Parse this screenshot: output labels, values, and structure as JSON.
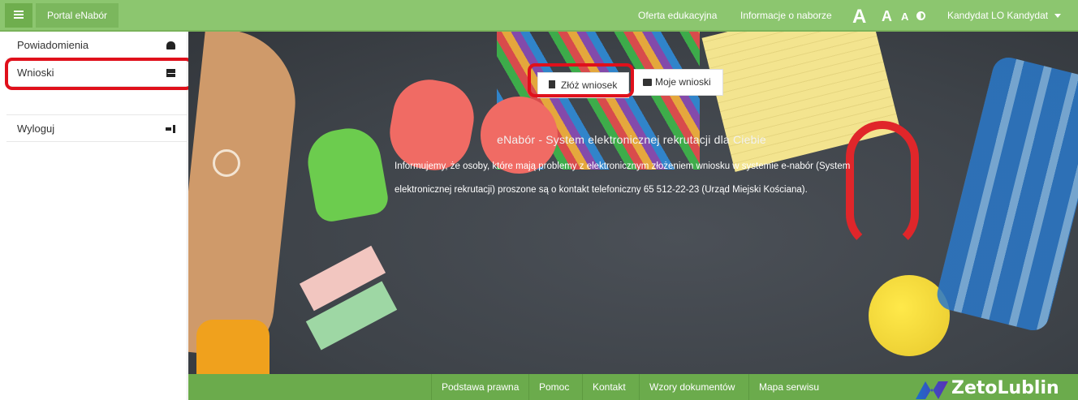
{
  "header": {
    "brand": "Portal eNabór",
    "nav": [
      "Oferta edukacyjna",
      "Informacje o naborze"
    ],
    "font_sizes": [
      "A",
      "A",
      "A"
    ],
    "user": "Kandydat LO Kandydat"
  },
  "sidebar": {
    "items": [
      {
        "label": "Powiadomienia",
        "icon": "bell-icon"
      },
      {
        "label": "Wnioski",
        "icon": "envelope-icon"
      },
      {
        "label": "Wyloguj",
        "icon": "sign-out-icon"
      }
    ]
  },
  "hero": {
    "buttons": [
      {
        "label": "Złóż wniosek",
        "icon": "file-icon"
      },
      {
        "label": "Moje wnioski",
        "icon": "folder-icon"
      }
    ],
    "title": "eNabór - System elektronicznej rekrutacji dla Ciebie",
    "text": "Informujemy, że osoby, które mają problemy z elektronicznym złożeniem wniosku w systemie e-nabór (System elektronicznej rekrutacji) proszone są o kontakt telefoniczny 65 512-22-23 (Urząd Miejski Kościana)."
  },
  "footer": {
    "links": [
      "Podstawa prawna",
      "Pomoc",
      "Kontakt",
      "Wzory dokumentów",
      "Mapa serwisu"
    ],
    "logo": "ZetoLublin"
  },
  "colors": {
    "topbar": "#8cc66f",
    "footer": "#6bab4c",
    "highlight": "#e0101b"
  }
}
